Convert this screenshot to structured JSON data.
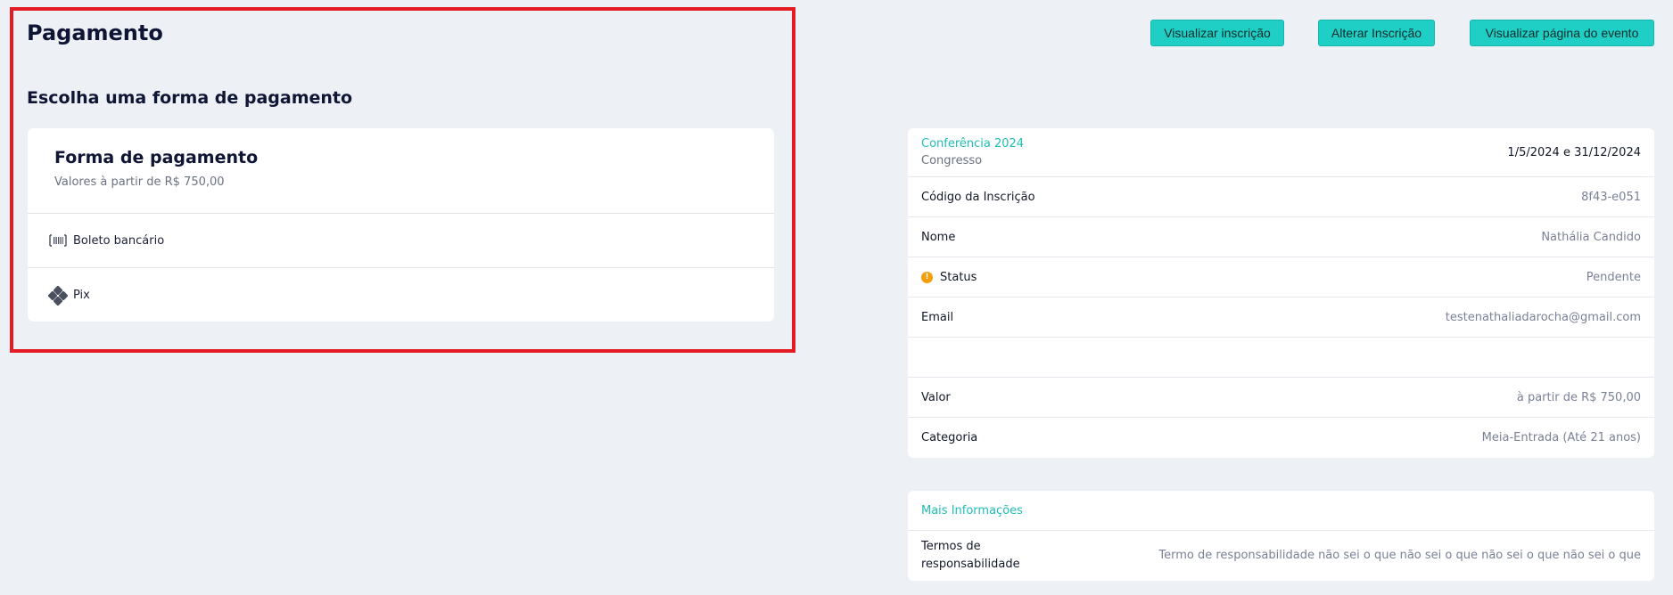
{
  "page": {
    "title": "Pagamento",
    "section_title": "Escolha uma forma de pagamento"
  },
  "payment_card": {
    "title": "Forma de pagamento",
    "subtitle": "Valores à partir de R$ 750,00",
    "options": [
      {
        "label": "Boleto bancário",
        "icon": "barcode-icon"
      },
      {
        "label": "Pix",
        "icon": "pix-icon"
      }
    ]
  },
  "actions": {
    "view_registration": "Visualizar inscrição",
    "change_registration": "Alterar Inscrição",
    "view_event_page": "Visualizar página do evento"
  },
  "event": {
    "name": "Conferência 2024",
    "type": "Congresso",
    "dates": "1/5/2024 e 31/12/2024"
  },
  "details": [
    {
      "label": "Código da Inscrição",
      "value": "8f43-e051"
    },
    {
      "label": "Nome",
      "value": "Nathália Candido"
    },
    {
      "label": "Status",
      "value": "Pendente",
      "icon": "warning-icon"
    },
    {
      "label": "Email",
      "value": "testenathaliadarocha@gmail.com"
    },
    {
      "label": "",
      "value": ""
    },
    {
      "label": "Valor",
      "value": "à partir de R$ 750,00"
    },
    {
      "label": "Categoria",
      "value": "Meia-Entrada (Até 21 anos)"
    }
  ],
  "more_info": {
    "title": "Mais Informações",
    "terms_label": "Termos de responsabilidade",
    "terms_value": "Termo de responsabilidade não sei o que não sei o que não sei o que não sei o que"
  },
  "colors": {
    "accent": "#1fcfc6",
    "highlight_border": "#e31b23",
    "status_pending": "#f59e0b",
    "background": "#edf1f5"
  }
}
